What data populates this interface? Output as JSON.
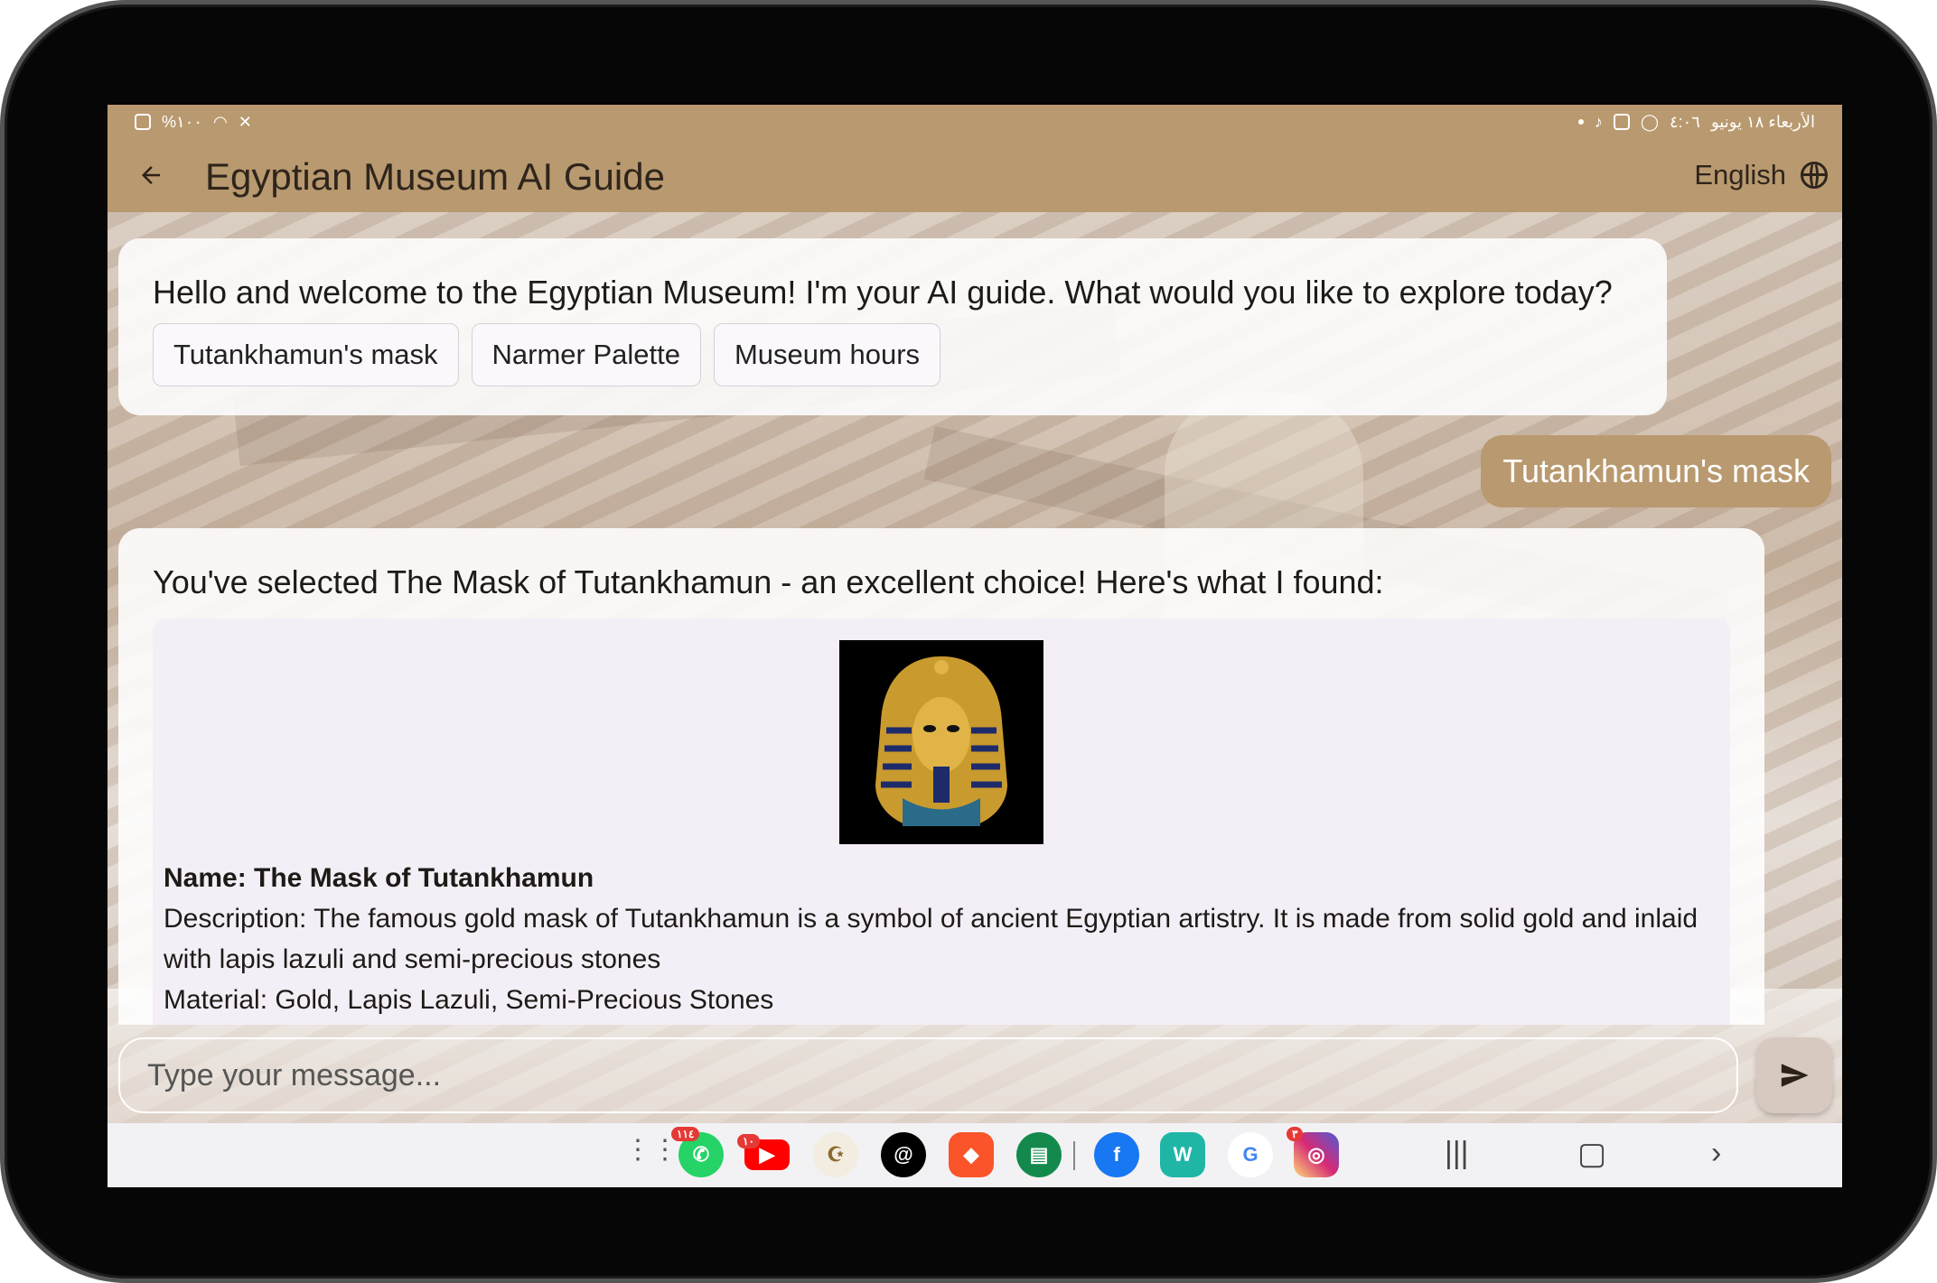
{
  "status_bar": {
    "left": "%١٠٠",
    "right_time": "٤:٠٦",
    "right_date": "الأربعاء ١٨ يونيو"
  },
  "app_bar": {
    "back_icon": "arrow-left-icon",
    "title": "Egyptian Museum AI Guide",
    "language": "English",
    "language_icon": "globe-icon"
  },
  "chat": {
    "welcome_message": "Hello and welcome to the Egyptian Museum! I'm your AI guide. What would you like to explore today?",
    "suggestions": [
      {
        "label": "Tutankhamun's mask"
      },
      {
        "label": "Narmer Palette"
      },
      {
        "label": "Museum hours"
      }
    ],
    "user_message": "Tutankhamun's mask",
    "bot_reply": "You've selected The Mask of Tutankhamun - an excellent choice! Here's what I found:",
    "artifact": {
      "name": "Name: The Mask of Tutankhamun",
      "description": "Description: The famous gold mask of Tutankhamun is a symbol of ancient Egyptian artistry. It is made from solid gold and inlaid with lapis lazuli and semi-precious stones",
      "material": "Material:  Gold, Lapis Lazuli, Semi-Precious Stones"
    }
  },
  "input": {
    "placeholder": "Type your message...",
    "send_icon": "send-icon"
  },
  "nav_bar": {
    "apps": [
      {
        "name": "app-drawer",
        "badge": ""
      },
      {
        "name": "whatsapp",
        "badge": "١١٤"
      },
      {
        "name": "youtube",
        "badge": "١٠"
      },
      {
        "name": "quran",
        "badge": ""
      },
      {
        "name": "threads",
        "badge": ""
      },
      {
        "name": "brave",
        "badge": ""
      },
      {
        "name": "book",
        "badge": ""
      },
      {
        "name": "facebook",
        "badge": ""
      },
      {
        "name": "wattpad",
        "badge": ""
      },
      {
        "name": "google",
        "badge": ""
      },
      {
        "name": "instagram",
        "badge": "٣"
      }
    ],
    "keys": [
      "recents",
      "home",
      "back"
    ]
  }
}
